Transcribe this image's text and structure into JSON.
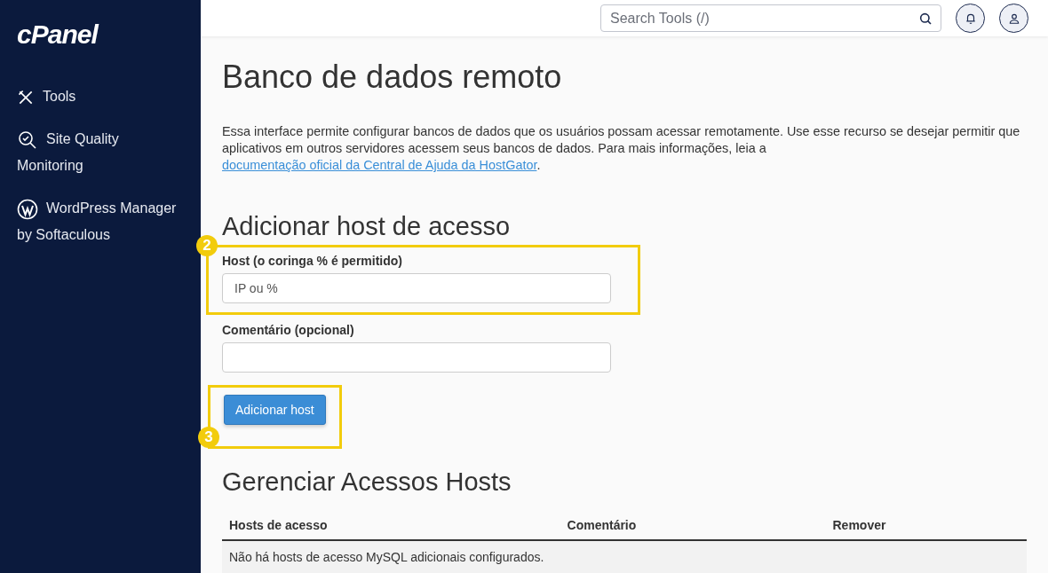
{
  "sidebar": {
    "logo": "cPanel",
    "items": [
      {
        "kind": "tools",
        "label": "Tools"
      },
      {
        "kind": "quality",
        "label": "Site Quality Monitoring"
      },
      {
        "kind": "wordpress",
        "label": "WordPress Manager by Softaculous"
      }
    ]
  },
  "topbar": {
    "search": {
      "placeholder": "Search Tools (/)"
    }
  },
  "page": {
    "title": "Banco de dados remoto",
    "description": {
      "text": "Essa interface permite configurar bancos de dados que os usuários possam acessar remotamente. Use esse recurso se desejar permitir que aplicativos em outros servidores acessem seus bancos de dados. Para mais informações, leia a ",
      "link": "documentação oficial da Central de Ajuda da HostGator",
      "after": "."
    },
    "add_section": {
      "title": "Adicionar host de acesso",
      "host_field": {
        "label": "Host (o coringa % é permitido)",
        "placeholder": "IP ou %",
        "step": "2"
      },
      "comment_field": {
        "label": "Comentário (opcional)"
      },
      "button": {
        "label": "Adicionar host",
        "step": "3"
      }
    },
    "manage_section": {
      "title": "Gerenciar Acessos Hosts",
      "table": {
        "columns": [
          "Hosts de acesso",
          "Comentário",
          "Remover"
        ],
        "empty_message": "Não há hosts de acesso MySQL adicionais configurados."
      }
    }
  }
}
